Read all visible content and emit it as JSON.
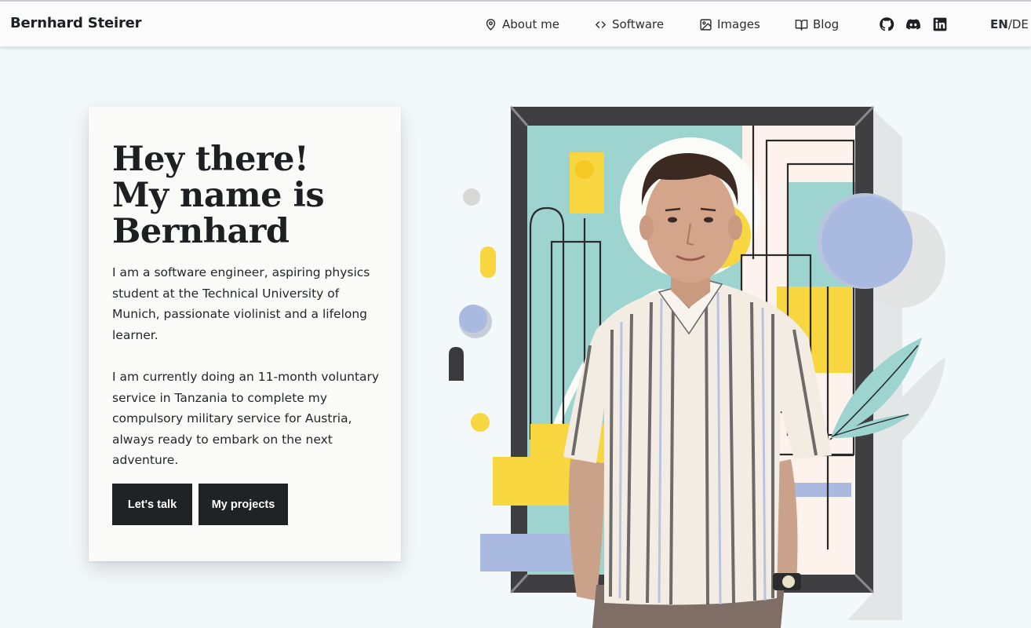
{
  "header": {
    "brand": "Bernhard Steirer",
    "nav": [
      {
        "label": "About me",
        "icon": "map-pin-icon"
      },
      {
        "label": "Software",
        "icon": "code-icon"
      },
      {
        "label": "Images",
        "icon": "image-icon"
      },
      {
        "label": "Blog",
        "icon": "book-icon"
      }
    ],
    "social": [
      "github-icon",
      "discord-icon",
      "linkedin-icon"
    ],
    "lang": {
      "active": "EN",
      "separator": "/",
      "other": "DE"
    }
  },
  "hero": {
    "headline": [
      "Hey there!",
      "My name is",
      "Bernhard"
    ],
    "paragraph1": "I am a software engineer, aspiring physics student at the Technical University of Munich, passionate violinist and a lifelong learner.",
    "paragraph2": "I am currently doing an 11-month voluntary service in Tanzania to complete my compulsory military service for Austria, always ready to embark on the next adventure.",
    "buttons": {
      "talk": "Let's talk",
      "projects": "My projects"
    }
  },
  "colors": {
    "background": "#f3f8fb",
    "header": "#fafbfa",
    "card": "#fafaf9",
    "button": "#1f2326",
    "teal": "#9dd4d0",
    "yellow": "#f7d640",
    "periwinkle": "#a9b9e0",
    "frame": "#3f3e41"
  }
}
